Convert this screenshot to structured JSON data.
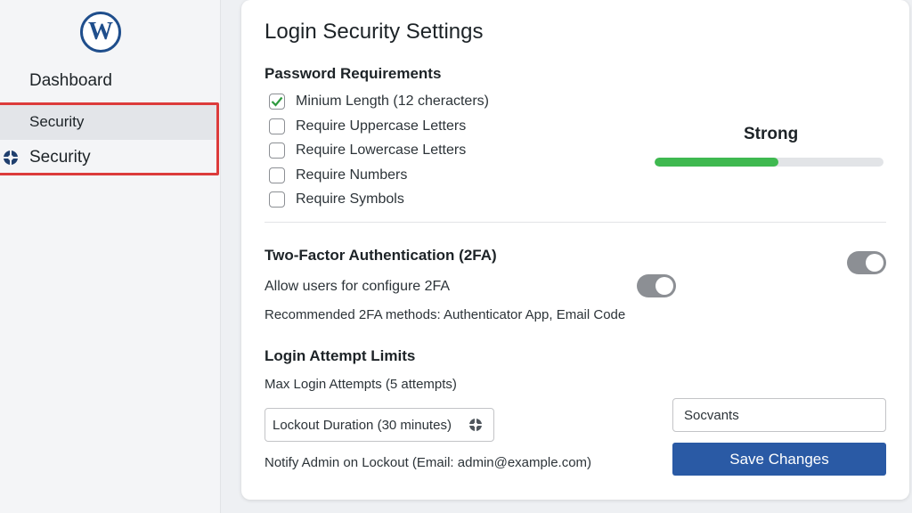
{
  "sidebar": {
    "logo_letter": "W",
    "items": [
      {
        "label": "Dashboard",
        "icon": "grid-icon"
      },
      {
        "label": "Security",
        "icon": "grid-icon"
      },
      {
        "label": "Security",
        "icon": "settings-icon"
      }
    ]
  },
  "main": {
    "title": "Login Security Settings",
    "password": {
      "heading": "Password Requirements",
      "options": [
        {
          "label": "Minium Length (12 cheracters)",
          "checked": true
        },
        {
          "label": "Require Uppercase Letters",
          "checked": false
        },
        {
          "label": "Require Lowercase Letters",
          "checked": false
        },
        {
          "label": "Require Numbers",
          "checked": false
        },
        {
          "label": "Require Symbols",
          "checked": false
        }
      ],
      "strength_label": "Strong",
      "strength_fraction": 0.54
    },
    "twofa": {
      "heading": "Two-Factor Authentication (2FA)",
      "allow_label": "Allow users for configure 2FA",
      "methods_text": "Recommended 2FA methods: Authenticator App, Email Code"
    },
    "login_limits": {
      "heading": "Login Attempt Limits",
      "max_attempts_text": "Max Login Attempts (5 attempts)",
      "lockout_select": "Lockout Duration (30 minutes)",
      "notify_text": "Notify Admin on Lockout (Email: admin@example.com)",
      "input_value": "Socvants",
      "save_label": "Save Changes"
    }
  },
  "colors": {
    "accent": "#2a5aa5",
    "strength": "#3fb950",
    "highlight": "#dc3b3b",
    "toggle": "#8c8f94"
  }
}
